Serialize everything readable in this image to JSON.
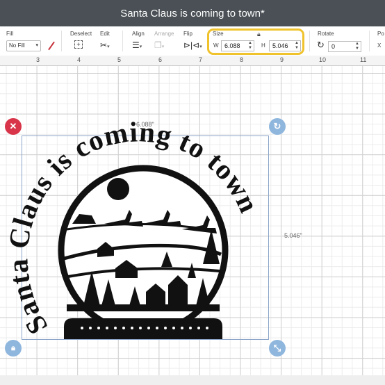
{
  "window": {
    "title": "Santa Claus is coming to town*"
  },
  "toolbar": {
    "fill": {
      "label": "Fill",
      "value": "No Fill"
    },
    "deselect": {
      "label": "Deselect"
    },
    "edit": {
      "label": "Edit"
    },
    "align": {
      "label": "Align"
    },
    "arrange": {
      "label": "Arrange"
    },
    "flip": {
      "label": "Flip"
    },
    "size": {
      "label": "Size",
      "w_label": "W",
      "w_value": "6.088",
      "h_label": "H",
      "h_value": "5.046"
    },
    "rotate": {
      "label": "Rotate",
      "value": "0"
    },
    "position": {
      "label": "Po",
      "x_label": "X"
    }
  },
  "ruler": {
    "marks": [
      "3",
      "4",
      "5",
      "6",
      "7",
      "8",
      "9",
      "10",
      "11"
    ]
  },
  "selection": {
    "width_label": "6.088\"",
    "height_label": "5.046\""
  },
  "design": {
    "arc_text": "Santa Claus is coming to town"
  },
  "colors": {
    "titlebar": "#4a5055",
    "highlight": "#f0c22c",
    "delete_handle": "#d8344a",
    "blue_handle": "#8fb6dd"
  }
}
